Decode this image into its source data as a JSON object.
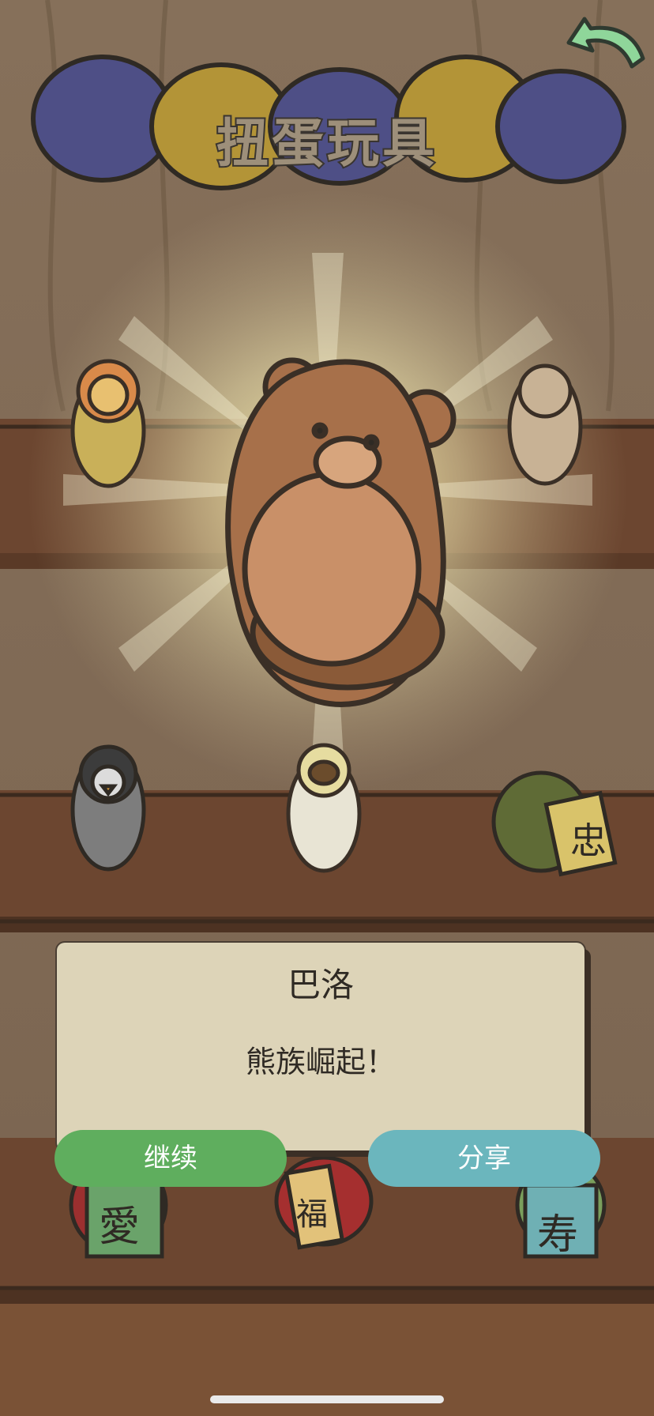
{
  "header": {
    "title": "扭蛋玩具"
  },
  "reward_dialog": {
    "name": "巴洛",
    "message": "熊族崛起！"
  },
  "buttons": {
    "continue_label": "继续",
    "share_label": "分享"
  },
  "shelf_tags": {
    "durian": "忠",
    "left_bottom": "愛",
    "middle_bottom": "福",
    "right_bottom": "寿"
  },
  "colors": {
    "continue": "#5fae5e",
    "share": "#6bb6bd",
    "dialog": "#ddd4b8",
    "wood": "#7b4a2d"
  }
}
